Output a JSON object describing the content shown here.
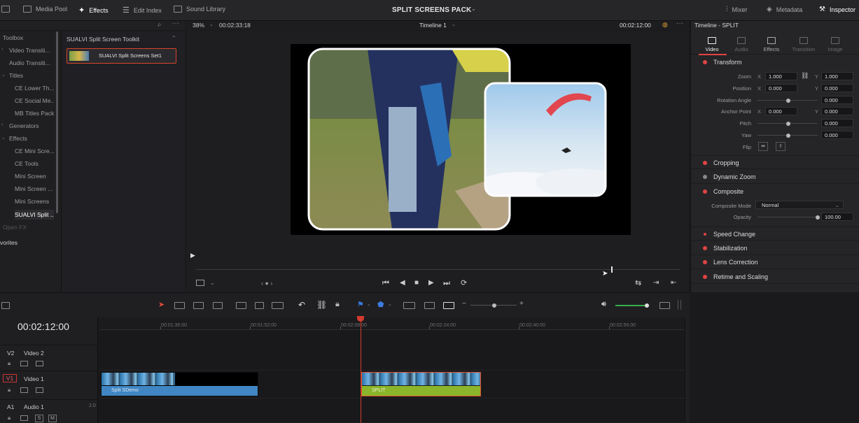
{
  "app": {
    "project_title": "SPLIT SCREENS PACK"
  },
  "top_tabs": [
    {
      "label": "Media Pool"
    },
    {
      "label": "Effects"
    },
    {
      "label": "Edit Index"
    },
    {
      "label": "Sound Library"
    }
  ],
  "right_tabs": [
    {
      "label": "Mixer"
    },
    {
      "label": "Metadata"
    },
    {
      "label": "Inspector"
    }
  ],
  "toolbox": {
    "header": "Toolbox",
    "items": [
      "Video Transiti...",
      "Audio Transiti...",
      "Titles",
      "CE Lower Th...",
      "CE Social Me...",
      "MB Titles Pack",
      "Generators",
      "Effects",
      "CE Mini Scre...",
      "CE Tools",
      "Mini Screen",
      "Mini Screen ...",
      "Mini Screens",
      "SUALVI Split ...",
      "Open FX"
    ],
    "favorites": "vorites"
  },
  "effects_panel": {
    "header": "SUALVI Split Screen Toolkit",
    "item": "SUALVI Split Screens Set1"
  },
  "viewer": {
    "zoom": "38%",
    "source_tc": "00:02:33:18",
    "timeline_name": "Timeline 1",
    "record_tc": "00:02:12:00"
  },
  "inspector": {
    "title": "Timeline - SPLIT",
    "tabs": [
      "Video",
      "Audio",
      "Effects",
      "Transition",
      "Image"
    ],
    "transform_label": "Transform",
    "zoom": {
      "label": "Zoom",
      "x": "1.000",
      "y": "1.000"
    },
    "position": {
      "label": "Position",
      "x": "0.000",
      "y": "0.000"
    },
    "rotation": {
      "label": "Rotation Angle",
      "value": "0.000"
    },
    "anchor": {
      "label": "Anchor Point",
      "x": "0.000",
      "y": "0.000"
    },
    "pitch": {
      "label": "Pitch",
      "value": "0.000"
    },
    "yaw": {
      "label": "Yaw",
      "value": "0.000"
    },
    "flip": {
      "label": "Flip"
    },
    "axis": {
      "x": "X",
      "y": "Y"
    },
    "sections": [
      "Cropping",
      "Dynamic Zoom",
      "Composite"
    ],
    "composite": {
      "mode_label": "Composite Mode",
      "mode_value": "Normal",
      "opacity_label": "Opacity",
      "opacity_value": "100.00"
    },
    "more_sections": [
      "Speed Change",
      "Stabilization",
      "Lens Correction",
      "Retime and Scaling"
    ]
  },
  "timeline": {
    "timecode": "00:02:12:00",
    "ruler": [
      "00:01:36:00",
      "00:01:52:00",
      "00:02:08:00",
      "00:02:24:00",
      "00:02:40:00",
      "00:02:56:00"
    ],
    "tracks": [
      {
        "id": "V2",
        "name": "Video 2"
      },
      {
        "id": "V1",
        "name": "Video 1"
      },
      {
        "id": "A1",
        "name": "Audio 1",
        "channels": "2.0"
      }
    ],
    "clips": [
      {
        "name": "Split SDemo"
      },
      {
        "name": "SPLIT"
      }
    ],
    "audio_btns": {
      "s": "S",
      "m": "M"
    }
  },
  "colors": {
    "accent_red": "#e04444",
    "clip_blue": "#3f86c3",
    "clip_green": "#8bb52a",
    "playhead": "#d43a2f"
  }
}
